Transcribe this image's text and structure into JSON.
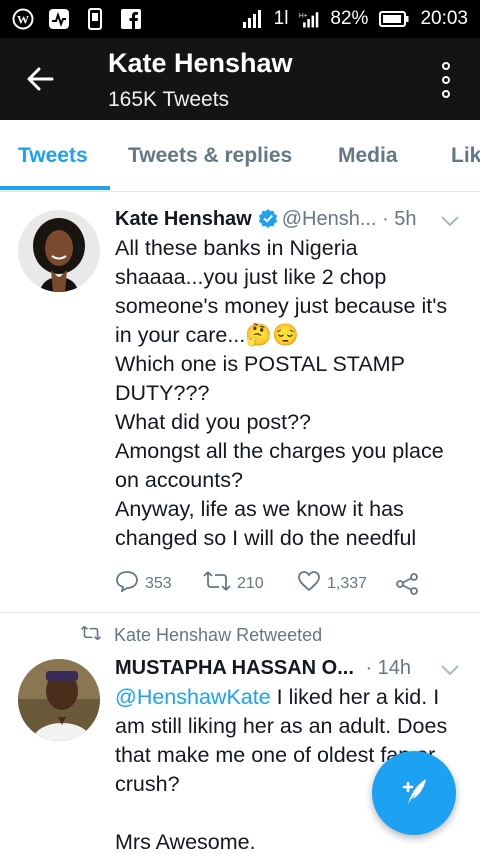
{
  "status_bar": {
    "battery": "82%",
    "time": "20:03",
    "net1": "1l",
    "net2": "H"
  },
  "header": {
    "title": "Kate Henshaw",
    "subtitle": "165K Tweets"
  },
  "tabs": [
    {
      "label": "Tweets",
      "active": true
    },
    {
      "label": "Tweets & replies",
      "active": false
    },
    {
      "label": "Media",
      "active": false
    },
    {
      "label": "Lik",
      "active": false
    }
  ],
  "tweet1": {
    "name": "Kate Henshaw",
    "handle": "@Hensh...",
    "time": "· 5h",
    "lines": [
      "All these banks in Nigeria",
      "shaaaa...you just like 2 chop",
      "someone's money just because it's",
      "in your care...🤔😔",
      "Which one is POSTAL STAMP",
      "DUTY???",
      "What did you post??",
      "Amongst all the charges you place",
      "on accounts?",
      "Anyway, life as we know it has",
      "changed so I will do the needful"
    ],
    "replies": "353",
    "retweets": "210",
    "likes": "1,337"
  },
  "tweet2": {
    "retweeted_label": "Kate Henshaw Retweeted",
    "name": "MUSTAPHA HASSAN O...",
    "time": "· 14h",
    "mention": "@HenshawKate",
    "line1_rest": " I liked her a kid. I",
    "lines": [
      "am still liking her as an adult. Does",
      "that make me one of oldest fan or",
      "crush?",
      "",
      "Mrs Awesome."
    ]
  },
  "colors": {
    "accent": "#1da1f2",
    "header_bg": "#141414",
    "muted": "#657786"
  },
  "icons": {
    "back": "arrow-left-icon",
    "more": "more-vertical-icon",
    "reply": "reply-icon",
    "retweet": "retweet-icon",
    "like": "heart-icon",
    "share": "share-icon",
    "compose": "compose-tweet-icon"
  }
}
